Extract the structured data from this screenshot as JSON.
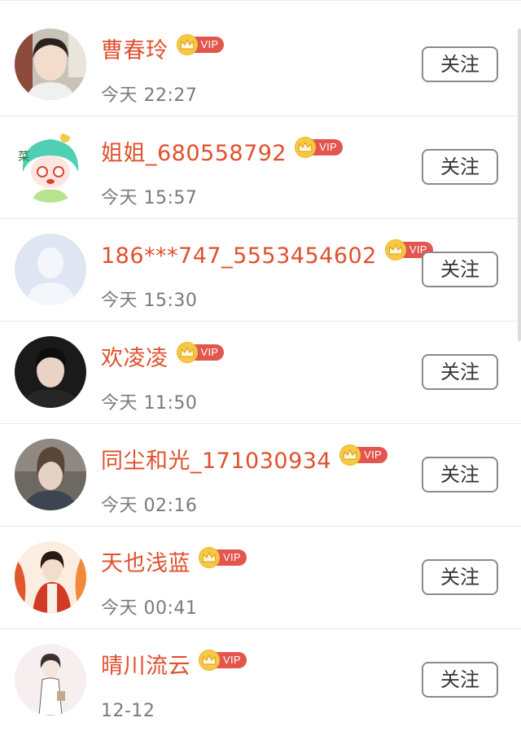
{
  "follow_label": "关注",
  "colors": {
    "name": "#e0502d",
    "vip_badge": "#e2564e",
    "crown": "#f6c945",
    "time": "#7a7a7a",
    "divider": "#e8e8e8"
  },
  "users": [
    {
      "name": "曹春玲",
      "time": "今天 22:27",
      "vip": "VIP",
      "avatar": "photo-woman-avatar"
    },
    {
      "name": "姐姐_680558792",
      "time": "今天 15:57",
      "vip": "VIP",
      "avatar": "cartoon-green-hair-avatar"
    },
    {
      "name": "186***747_5553454602",
      "time": "今天 15:30",
      "vip": "VIP",
      "avatar": "default-person-avatar"
    },
    {
      "name": "欢凌凌",
      "time": "今天 11:50",
      "vip": "VIP",
      "avatar": "photo-man-avatar"
    },
    {
      "name": "同尘和光_171030934",
      "time": "今天 02:16",
      "vip": "VIP",
      "avatar": "illustrated-girl-avatar"
    },
    {
      "name": "天也浅蓝",
      "time": "今天 00:41",
      "vip": "VIP",
      "avatar": "illustrated-red-robe-avatar"
    },
    {
      "name": "晴川流云",
      "time": "12-12",
      "vip": "VIP",
      "avatar": "sketch-girl-avatar"
    }
  ]
}
